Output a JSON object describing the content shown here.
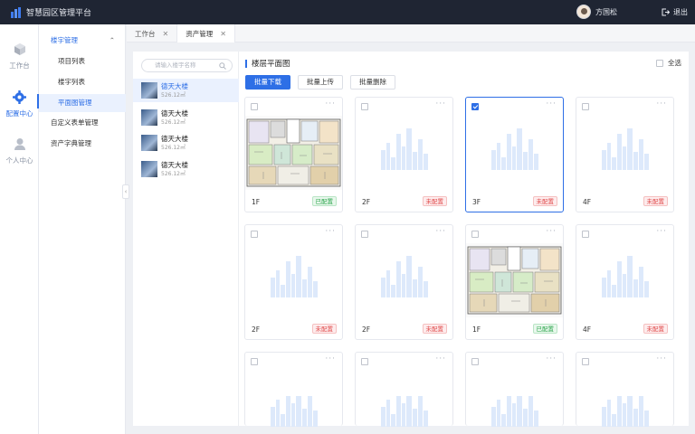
{
  "app": {
    "title": "智慧园区管理平台"
  },
  "user": {
    "name": "方国松",
    "logout": "退出"
  },
  "rail": [
    {
      "label": "工作台",
      "icon": "cube-icon"
    },
    {
      "label": "配置中心",
      "icon": "gear-icon"
    },
    {
      "label": "个人中心",
      "icon": "user-icon"
    }
  ],
  "submenu": {
    "group": "楼宇管理",
    "items": [
      "项目列表",
      "楼宇列表",
      "平面图管理"
    ],
    "others": [
      "自定义表单管理",
      "资产字典管理"
    ]
  },
  "tabs": [
    {
      "label": "工作台",
      "close": "✕"
    },
    {
      "label": "资产管理",
      "close": "✕"
    }
  ],
  "buildings": {
    "search_placeholder": "请输入楼宇名称",
    "items": [
      {
        "name": "德天大楼",
        "area": "526.12㎡"
      },
      {
        "name": "德天大楼",
        "area": "526.12㎡"
      },
      {
        "name": "德天大楼",
        "area": "526.12㎡"
      },
      {
        "name": "德天大楼",
        "area": "526.12㎡"
      }
    ]
  },
  "main": {
    "title": "楼层平面图",
    "select_all": "全选",
    "buttons": [
      "批量下载",
      "批量上传",
      "批量删除"
    ],
    "more": "···",
    "cards": [
      {
        "floor": "1F",
        "status": "已配置",
        "configured": true,
        "checked": false
      },
      {
        "floor": "2F",
        "status": "未配置",
        "configured": false,
        "checked": false
      },
      {
        "floor": "3F",
        "status": "未配置",
        "configured": false,
        "checked": true
      },
      {
        "floor": "4F",
        "status": "未配置",
        "configured": false,
        "checked": false
      },
      {
        "floor": "2F",
        "status": "未配置",
        "configured": false,
        "checked": false
      },
      {
        "floor": "2F",
        "status": "未配置",
        "configured": false,
        "checked": false
      },
      {
        "floor": "1F",
        "status": "已配置",
        "configured": true,
        "checked": false
      },
      {
        "floor": "4F",
        "status": "未配置",
        "configured": false,
        "checked": false
      }
    ]
  },
  "colors": {
    "accent": "#2e6fe6",
    "topbar": "#1f2533",
    "ok": "#2aa54a",
    "no": "#e04848"
  }
}
